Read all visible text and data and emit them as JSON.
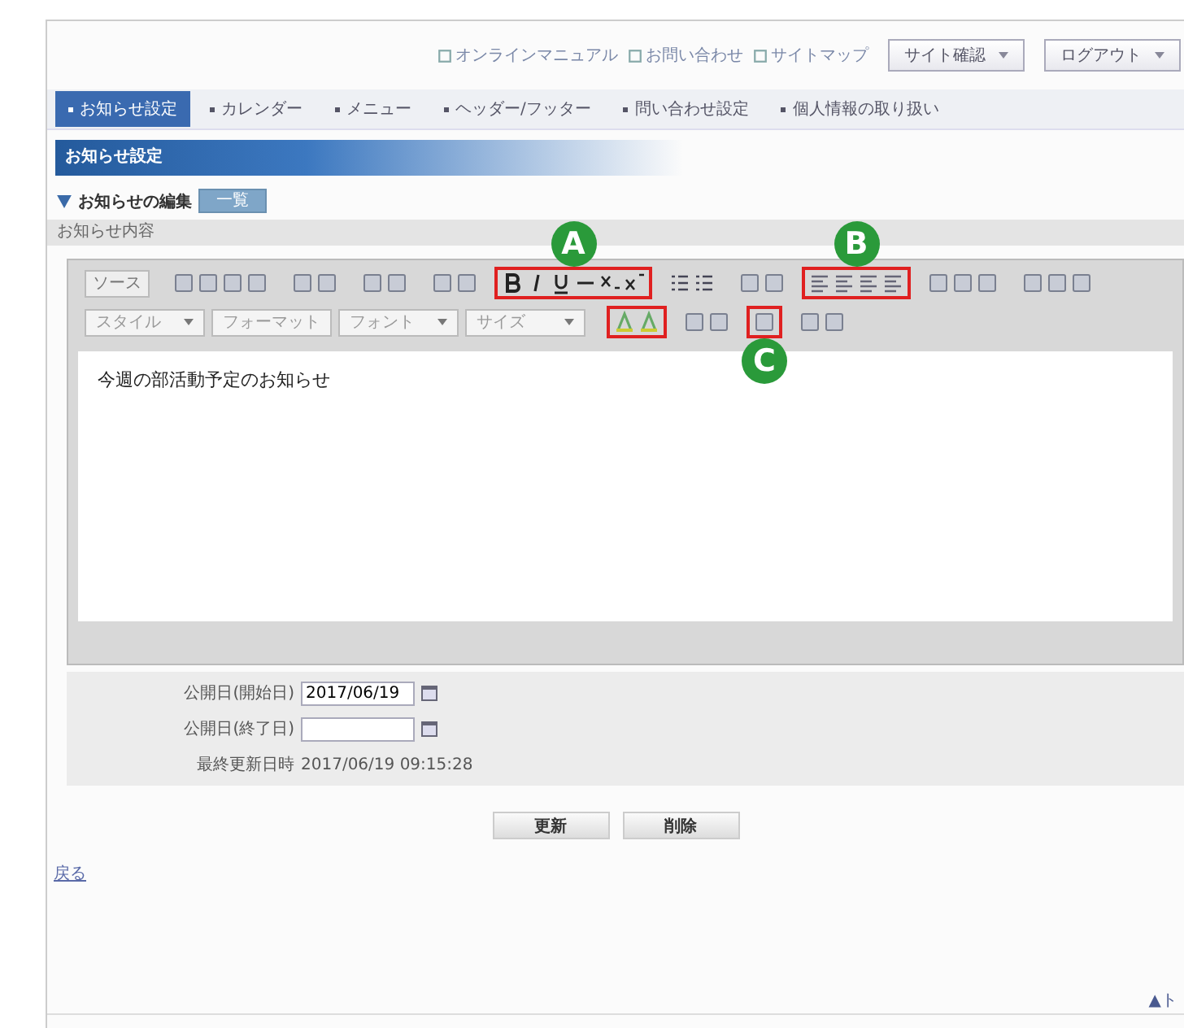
{
  "header_links": [
    {
      "label": "オンラインマニュアル"
    },
    {
      "label": "お問い合わせ"
    },
    {
      "label": "サイトマップ"
    }
  ],
  "header_buttons": [
    {
      "label": "サイト確認"
    },
    {
      "label": "ログアウト"
    }
  ],
  "tabs": [
    {
      "label": "お知らせ設定",
      "selected": true
    },
    {
      "label": "カレンダー",
      "selected": false
    },
    {
      "label": "メニュー",
      "selected": false
    },
    {
      "label": "ヘッダー/フッター",
      "selected": false
    },
    {
      "label": "問い合わせ設定",
      "selected": false
    },
    {
      "label": "個人情報の取り扱い",
      "selected": false
    }
  ],
  "page_title": "お知らせ設定",
  "section": {
    "title": "お知らせの編集",
    "button": "一覧"
  },
  "field_label": "お知らせ内容",
  "toolbar_rows": [
    [
      {
        "kind": "plain",
        "items": [
          {
            "kind": "source",
            "label": "ソース"
          }
        ]
      },
      {
        "kind": "plain",
        "items": [
          {
            "kind": "icon"
          },
          {
            "kind": "icon"
          },
          {
            "kind": "icon"
          },
          {
            "kind": "icon"
          }
        ]
      },
      {
        "kind": "plain",
        "items": [
          {
            "kind": "icon"
          },
          {
            "kind": "icon"
          }
        ]
      },
      {
        "kind": "plain",
        "items": [
          {
            "kind": "icon"
          },
          {
            "kind": "icon"
          }
        ]
      },
      {
        "kind": "plain",
        "items": [
          {
            "kind": "icon"
          },
          {
            "kind": "icon"
          }
        ]
      },
      {
        "kind": "highlighted",
        "callout": "A",
        "items": [
          {
            "kind": "bold"
          },
          {
            "kind": "italic"
          },
          {
            "kind": "underline"
          },
          {
            "kind": "strike"
          },
          {
            "kind": "sub"
          },
          {
            "kind": "sup"
          }
        ]
      },
      {
        "kind": "plain",
        "items": [
          {
            "kind": "list"
          },
          {
            "kind": "list"
          }
        ]
      },
      {
        "kind": "plain",
        "items": [
          {
            "kind": "icon"
          },
          {
            "kind": "icon"
          }
        ]
      },
      {
        "kind": "highlighted",
        "callout": "B",
        "items": [
          {
            "kind": "align"
          },
          {
            "kind": "align"
          },
          {
            "kind": "align"
          },
          {
            "kind": "align"
          }
        ]
      },
      {
        "kind": "plain",
        "items": [
          {
            "kind": "icon"
          },
          {
            "kind": "icon"
          },
          {
            "kind": "icon"
          }
        ]
      },
      {
        "kind": "plain",
        "items": [
          {
            "kind": "icon"
          },
          {
            "kind": "icon"
          },
          {
            "kind": "icon"
          }
        ]
      }
    ],
    [
      {
        "kind": "plain",
        "items": [
          {
            "kind": "select",
            "label": "スタイル"
          },
          {
            "kind": "select",
            "label": "フォーマット"
          },
          {
            "kind": "select",
            "label": "フォント"
          },
          {
            "kind": "select",
            "label": "サイズ"
          }
        ]
      },
      {
        "kind": "highlighted",
        "items": [
          {
            "kind": "color"
          },
          {
            "kind": "color"
          }
        ]
      },
      {
        "kind": "plain",
        "items": [
          {
            "kind": "icon"
          },
          {
            "kind": "icon"
          }
        ]
      },
      {
        "kind": "highlighted",
        "callout": "C",
        "items": [
          {
            "kind": "icon"
          }
        ]
      },
      {
        "kind": "plain",
        "items": [
          {
            "kind": "icon"
          },
          {
            "kind": "icon"
          }
        ]
      }
    ]
  ],
  "content": "今週の部活動予定のお知らせ",
  "form": [
    {
      "label": "公開日(開始日)",
      "kind": "date",
      "value": "2017/06/19"
    },
    {
      "label": "公開日(終了日)",
      "kind": "date"
    },
    {
      "label": "最終更新日時",
      "kind": "text",
      "value": "2017/06/19 09:15:28"
    }
  ],
  "actions": [
    {
      "label": "更新"
    },
    {
      "label": "削除"
    }
  ],
  "back_link": "戻る",
  "page_top": "▲ト"
}
